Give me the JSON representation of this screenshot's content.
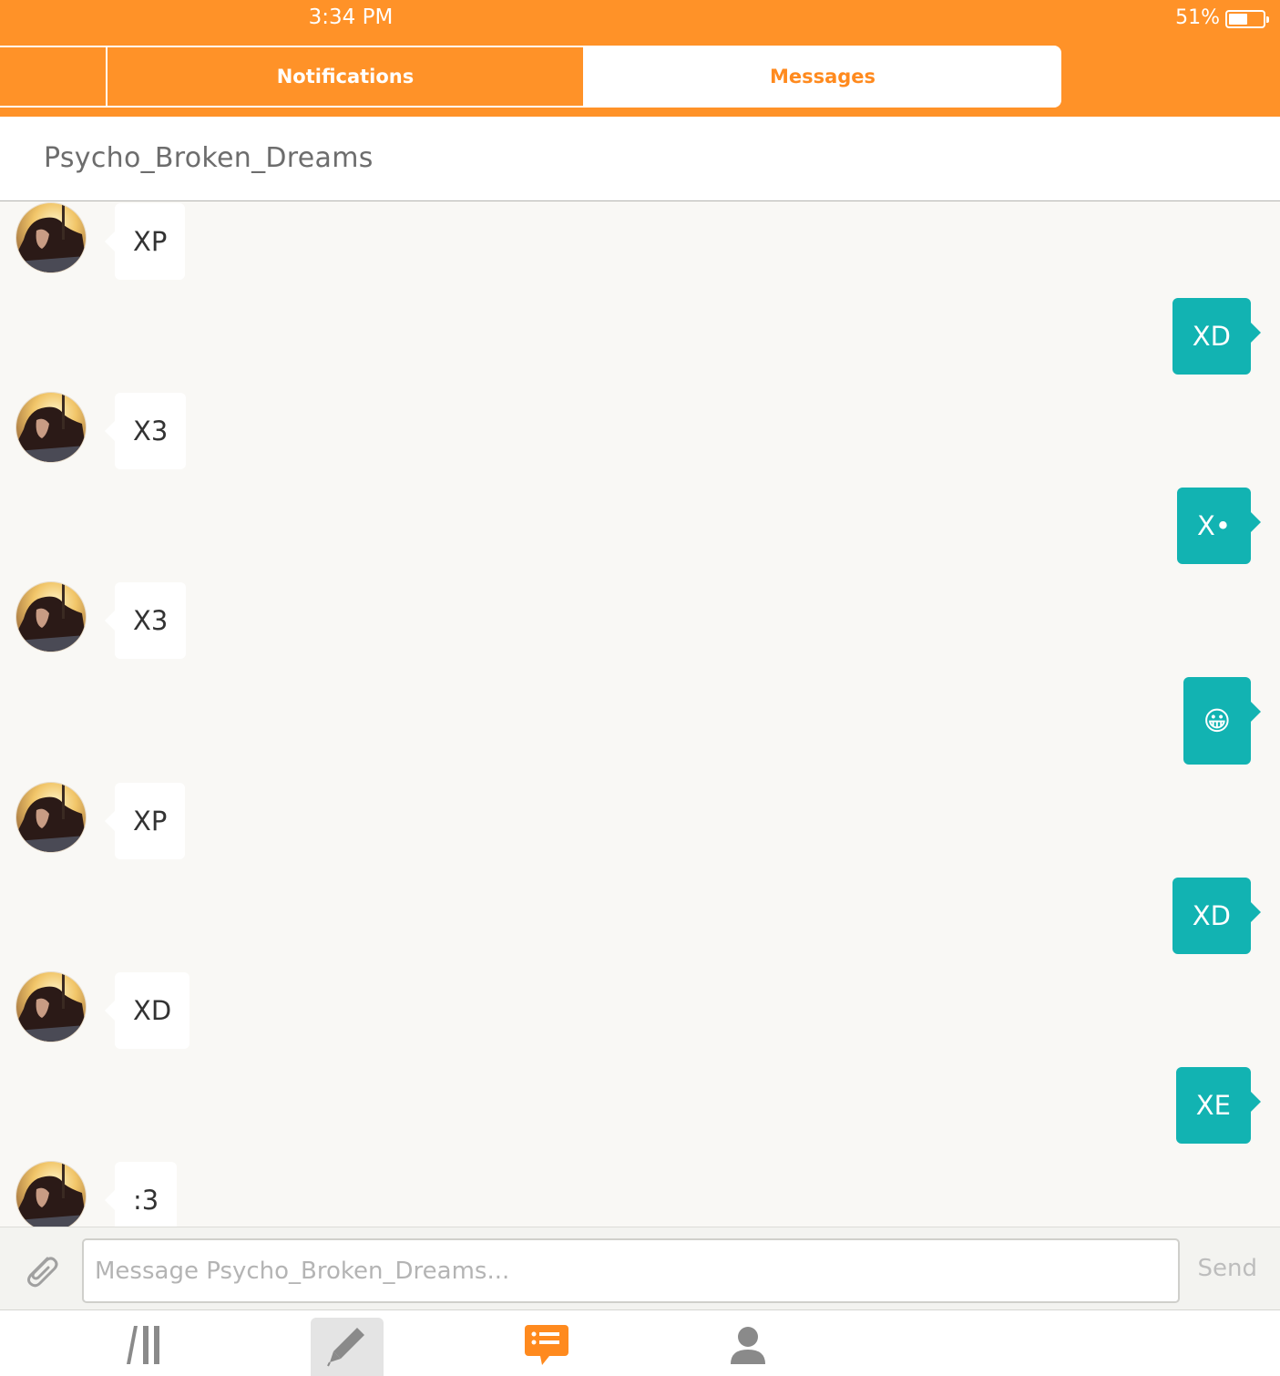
{
  "status_bar": {
    "time": "3:34 PM",
    "battery": "51%"
  },
  "tabs": [
    {
      "label": "",
      "active": false
    },
    {
      "label": "Notifications",
      "active": false
    },
    {
      "label": "Messages",
      "active": true
    }
  ],
  "conversation": {
    "title": "Psycho_Broken_Dreams"
  },
  "messages": [
    {
      "side": "in",
      "text": "XP"
    },
    {
      "side": "out",
      "text": "XD"
    },
    {
      "side": "in",
      "text": "X3"
    },
    {
      "side": "out",
      "text": "X•"
    },
    {
      "side": "in",
      "text": "X3"
    },
    {
      "side": "out",
      "text": "😀"
    },
    {
      "side": "in",
      "text": "XP"
    },
    {
      "side": "out",
      "text": "XD"
    },
    {
      "side": "in",
      "text": "XD"
    },
    {
      "side": "out",
      "text": "XE"
    },
    {
      "side": "in",
      "text": ":3"
    }
  ],
  "composer": {
    "placeholder": "Message Psycho_Broken_Dreams...",
    "send_label": "Send"
  },
  "bottom_nav": [
    {
      "icon": "library-icon",
      "active": false
    },
    {
      "icon": "pencil-icon",
      "active": false
    },
    {
      "icon": "messages-icon",
      "active": true
    },
    {
      "icon": "profile-icon",
      "active": false
    }
  ],
  "colors": {
    "brand_orange": "#ff9228",
    "outgoing_bubble": "#12b3b2",
    "incoming_bubble": "#ffffff",
    "thread_background": "#f9f8f5"
  }
}
